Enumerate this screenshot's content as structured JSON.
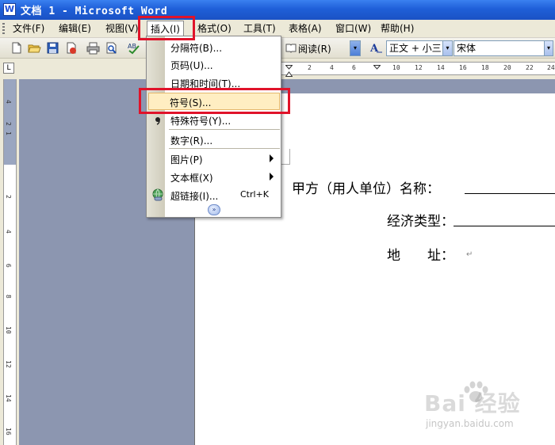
{
  "window": {
    "title": "文档 1 - Microsoft Word"
  },
  "menubar": {
    "items": [
      {
        "label": "文件(F)"
      },
      {
        "label": "编辑(E)"
      },
      {
        "label": "视图(V)"
      },
      {
        "label": "插入(I)"
      },
      {
        "label": "格式(O)"
      },
      {
        "label": "工具(T)"
      },
      {
        "label": "表格(A)"
      },
      {
        "label": "窗口(W)"
      },
      {
        "label": "帮助(H)"
      }
    ],
    "open_menu": "插入(I)"
  },
  "toolbar": {
    "read_label": "阅读(R)",
    "style_value": "正文 + 小三",
    "font_value": "宋体",
    "style_icon": "style-a-icon"
  },
  "ruler": {
    "corner_glyph": "L",
    "h_ticks": [
      "2",
      "2",
      "4",
      "6",
      "8",
      "10",
      "12",
      "14",
      "16",
      "18",
      "20",
      "22",
      "24"
    ],
    "v_ticks": [
      "4",
      "2",
      "1",
      "2",
      "4",
      "6",
      "8",
      "10",
      "12",
      "14",
      "16"
    ]
  },
  "insert_menu": {
    "items": [
      {
        "label": "分隔符(B)...",
        "submenu": false,
        "shortcut": ""
      },
      {
        "label": "页码(U)...",
        "submenu": false,
        "shortcut": ""
      },
      {
        "label": "日期和时间(T)...",
        "submenu": false,
        "shortcut": ""
      },
      {
        "label": "符号(S)...",
        "submenu": false,
        "shortcut": "",
        "highlighted": true
      },
      {
        "label": "特殊符号(Y)...",
        "submenu": false,
        "shortcut": ""
      },
      {
        "label": "数字(R)...",
        "submenu": false,
        "shortcut": ""
      },
      {
        "label": "图片(P)",
        "submenu": true,
        "shortcut": ""
      },
      {
        "label": "文本框(X)",
        "submenu": true,
        "shortcut": ""
      },
      {
        "label": "超链接(I)...",
        "submenu": false,
        "shortcut": "Ctrl+K"
      }
    ],
    "more_glyph": "»"
  },
  "document": {
    "lines": [
      {
        "text": "甲方（用人单位）名称："
      },
      {
        "text": "经济类型："
      },
      {
        "text": "地　　址："
      }
    ],
    "para_mark": "↵"
  },
  "watermark": {
    "main": "Bai 经验",
    "sub": "jingyan.baidu.com"
  },
  "colors": {
    "titlebar": "#1f5fd8",
    "highlight_box": "#e0132a",
    "menu_hover": "#ffeec2",
    "workspace": "#8c96b0"
  }
}
